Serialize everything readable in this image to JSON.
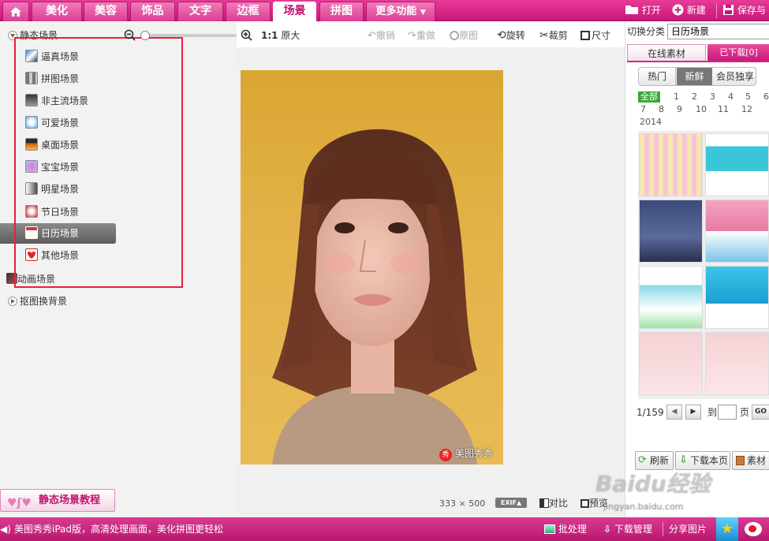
{
  "nav": {
    "tabs": [
      "美化",
      "美容",
      "饰品",
      "文字",
      "边框",
      "场景",
      "拼图"
    ],
    "more": "更多功能",
    "active_tab": "场景",
    "open": "打开",
    "new": "新建",
    "save": "保存与"
  },
  "toolbar": {
    "ratio": "1:1",
    "original_size": "原大",
    "undo": "撤销",
    "redo": "重做",
    "original": "原图",
    "rotate": "旋转",
    "crop": "裁剪",
    "size": "尺寸"
  },
  "left": {
    "static_head": "静态场景",
    "items": [
      "逼真场景",
      "拼图场景",
      "非主流场景",
      "可爱场景",
      "桌面场景",
      "宝宝场景",
      "明星场景",
      "节日场景",
      "日历场景",
      "其他场景"
    ],
    "selected": "日历场景",
    "anim_head": "动画场景",
    "matting_head": "抠图换背景",
    "tutorial": "静态场景教程"
  },
  "canvas": {
    "watermark": "美图秀秀",
    "badge": "秀",
    "dims_w": "333",
    "dims_x": "×",
    "dims_h": "500",
    "exif": "EXIF▲",
    "compare": "对比",
    "preview": "预览"
  },
  "right": {
    "category_label": "切换分类",
    "category_value": "日历场景",
    "tab_online": "在线素材",
    "tab_downloaded": "已下载[0]",
    "filters": [
      "热门",
      "新鲜",
      "会员独享"
    ],
    "filter_active": "新鲜",
    "nums_row1": [
      "全部",
      "1",
      "2",
      "3",
      "4",
      "5",
      "6"
    ],
    "nums_row2": [
      "7",
      "8",
      "9",
      "10",
      "11",
      "12"
    ],
    "year": "2014",
    "page": "1/159",
    "goto": "到",
    "page_unit": "页",
    "go": "GO",
    "refresh": "刷新",
    "download_page": "下载本页",
    "material": "素材"
  },
  "status": {
    "ad": "美图秀秀iPad版，高清处理画面，美化拼图更轻松",
    "batch": "批处理",
    "download_mgr": "下载管理",
    "share": "分享图片"
  },
  "watermark_site": {
    "name": "Baidu经验",
    "url": "jingyan.baidu.com"
  },
  "colors": {
    "brand": "#d0287f",
    "accent_green": "#3aa83a",
    "highlight_red": "#e8213e"
  }
}
